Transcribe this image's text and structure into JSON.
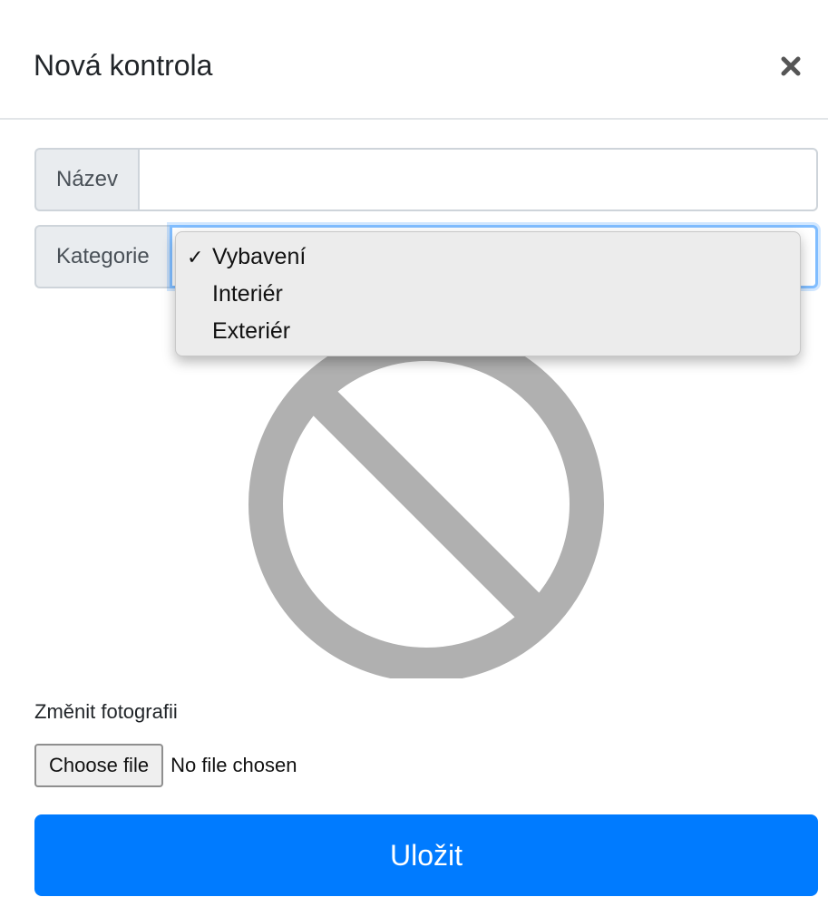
{
  "modal": {
    "title": "Nová kontrola",
    "close_icon": "close-icon"
  },
  "form": {
    "name_label": "Název",
    "name_value": "",
    "category_label": "Kategorie",
    "category_selected": "Vybavení",
    "category_options": [
      {
        "label": "Vybavení",
        "selected": true
      },
      {
        "label": "Interiér",
        "selected": false
      },
      {
        "label": "Exteriér",
        "selected": false
      }
    ],
    "check_mark": "✓",
    "placeholder_icon": "no-image-icon",
    "photo_label": "Změnit fotografii",
    "file_button_label": "Choose file",
    "file_status": "No file chosen",
    "save_label": "Uložit"
  },
  "colors": {
    "primary": "#007bff",
    "addon_bg": "#e9ecef",
    "border": "#ced4da",
    "focus_border": "#80bdff",
    "placeholder_icon": "#b0b0b0"
  }
}
